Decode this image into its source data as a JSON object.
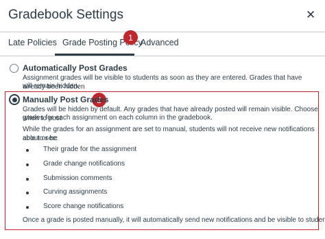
{
  "dialog": {
    "title": "Gradebook Settings",
    "close_glyph": "✕"
  },
  "tabs": [
    {
      "label": "Late Policies",
      "selected": false
    },
    {
      "label": "Grade Posting Policy",
      "selected": true
    },
    {
      "label": "Advanced",
      "selected": false
    }
  ],
  "callouts": [
    "1",
    "2"
  ],
  "options": {
    "auto": {
      "label": "Automatically Post Grades",
      "desc_line1": "Assignment grades will be visible to students as soon as they are entered. Grades that have already been hidden",
      "desc_line2": "will remain hidden.",
      "selected": false
    },
    "manual": {
      "label": "Manually Post Grades",
      "selected": true,
      "desc_line1": "Grades will be hidden by default. Any grades that have already posted will remain visible. Choose when to post",
      "desc_line2": "grades for each assignment on each column in the gradebook.",
      "note_line1": "While the grades for an assignment are set to manual, students will not receive new notifications about or be",
      "note_line2": "able to see:",
      "bullets": [
        "Their grade for the assignment",
        "Grade change notifications",
        "Submission comments",
        "Curving assignments",
        "Score change notifications"
      ],
      "footer": "Once a grade is posted manually, it will automatically send new notifications and be visible to students."
    }
  },
  "colors": {
    "text": "#2d3b45",
    "callout_red": "#c0272d",
    "highlight_border": "#c7202a",
    "divider": "#c7cdd1"
  }
}
